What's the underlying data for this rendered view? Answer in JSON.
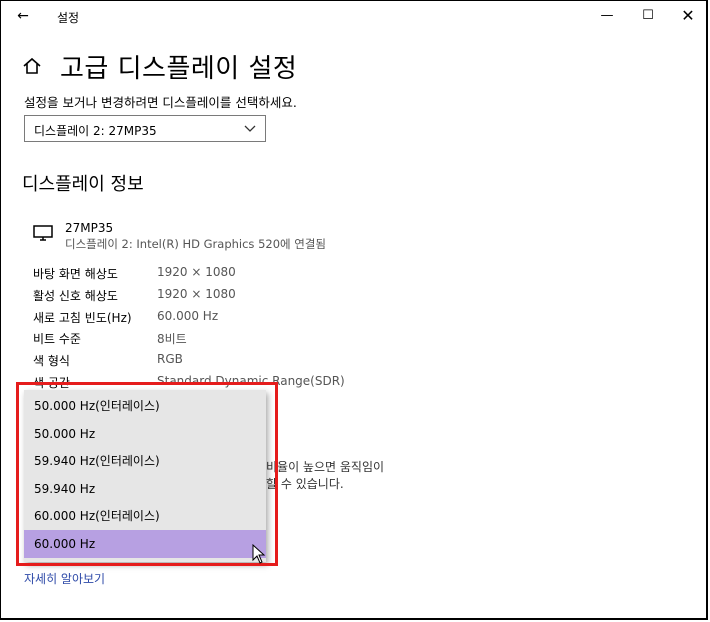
{
  "window": {
    "title": "설정",
    "back_icon": "←",
    "min_icon": "—",
    "max_icon": "☐",
    "close_icon": "✕"
  },
  "page": {
    "title": "고급 디스플레이 설정",
    "subtitle": "설정을 보거나 변경하려면 디스플레이를 선택하세요.",
    "display_select_value": "디스플레이 2: 27MP35"
  },
  "display_info": {
    "section_title": "디스플레이 정보",
    "monitor_name": "27MP35",
    "monitor_desc": "디스플레이 2: Intel(R) HD Graphics 520에 연결됨",
    "rows": [
      {
        "label": "바탕 화면 해상도",
        "value": "1920 × 1080"
      },
      {
        "label": "활성 신호 해상도",
        "value": "1920 × 1080"
      },
      {
        "label": "새로 고침 빈도(Hz)",
        "value": "60.000 Hz"
      },
      {
        "label": "비트 수준",
        "value": "8비트"
      },
      {
        "label": "색 형식",
        "value": "RGB"
      },
      {
        "label": "색 공간",
        "value": "Standard Dynamic Range(SDR)"
      }
    ]
  },
  "partial_text": {
    "line1": "비율이 높으면 움직임이",
    "line2": "할 수 있습니다."
  },
  "refresh_dropdown": {
    "options": [
      "50.000 Hz(인터레이스)",
      "50.000 Hz",
      "59.940 Hz(인터레이스)",
      "59.940 Hz",
      "60.000 Hz(인터레이스)",
      "60.000 Hz"
    ],
    "selected": "60.000 Hz"
  },
  "learn_more": "자세히 알아보기",
  "colors": {
    "selected_bg": "#b7a0e2",
    "highlight": "#e51c1c",
    "link": "#2e4aa8"
  }
}
